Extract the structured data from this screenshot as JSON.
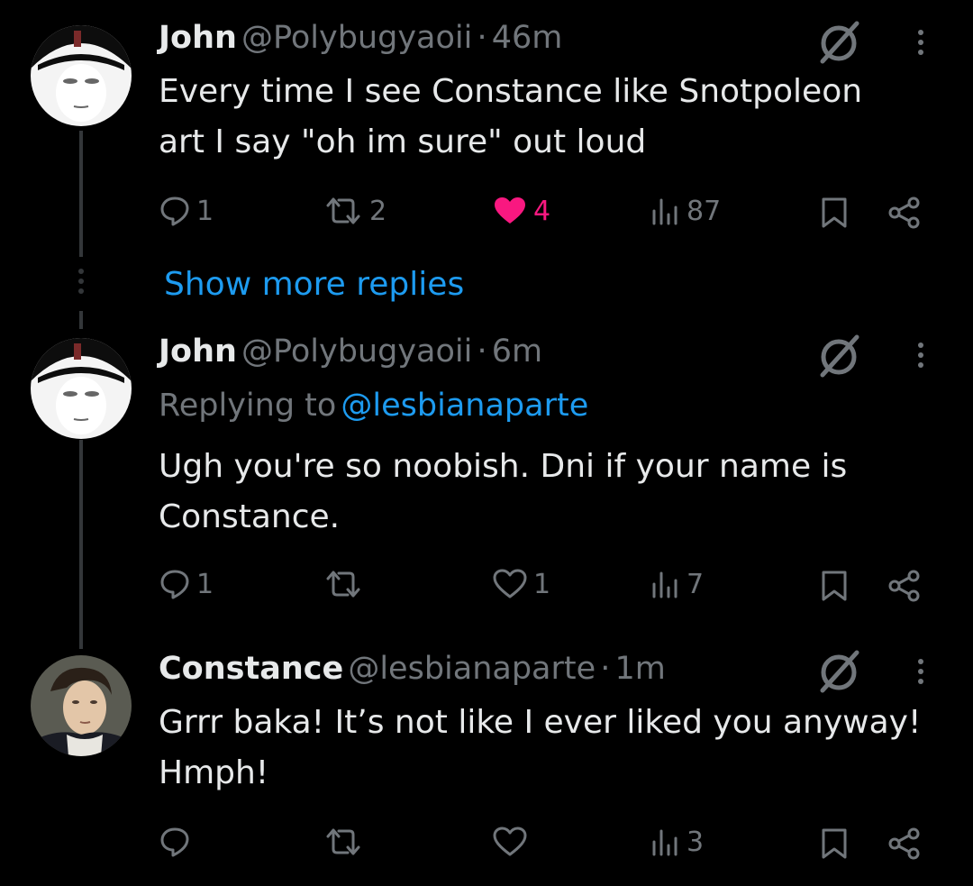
{
  "tweets": [
    {
      "name": "John",
      "handle": "@Polybugyaoii",
      "separator": "·",
      "time": "46m",
      "line1": "Every time I see Constance like Snotpoleon",
      "line2": "art I say \"oh im sure\" out loud",
      "replies": "1",
      "retweets": "2",
      "likes": "4",
      "views": "87"
    },
    {
      "name": "John",
      "handle": "@Polybugyaoii",
      "separator": "·",
      "time": "6m",
      "replying_prefix": "Replying to",
      "replying_to": "@lesbianaparte",
      "line1": "Ugh you're so noobish. Dni if your name is",
      "line2": "Constance.",
      "replies": "1",
      "retweets": "",
      "likes": "1",
      "views": "7"
    },
    {
      "name": "Constance",
      "handle": "@lesbianaparte",
      "separator": "·",
      "time": "1m",
      "line1": "Grrr baka! It’s not like I ever liked you anyway!",
      "line2": "Hmph!",
      "replies": "",
      "retweets": "",
      "likes": "",
      "views": "3"
    }
  ],
  "show_more": "Show more replies",
  "colors": {
    "background": "#000000",
    "text": "#e7e9ea",
    "muted": "#71767b",
    "link": "#1d9bf0",
    "like": "#f91880",
    "thread_line": "#333639"
  }
}
